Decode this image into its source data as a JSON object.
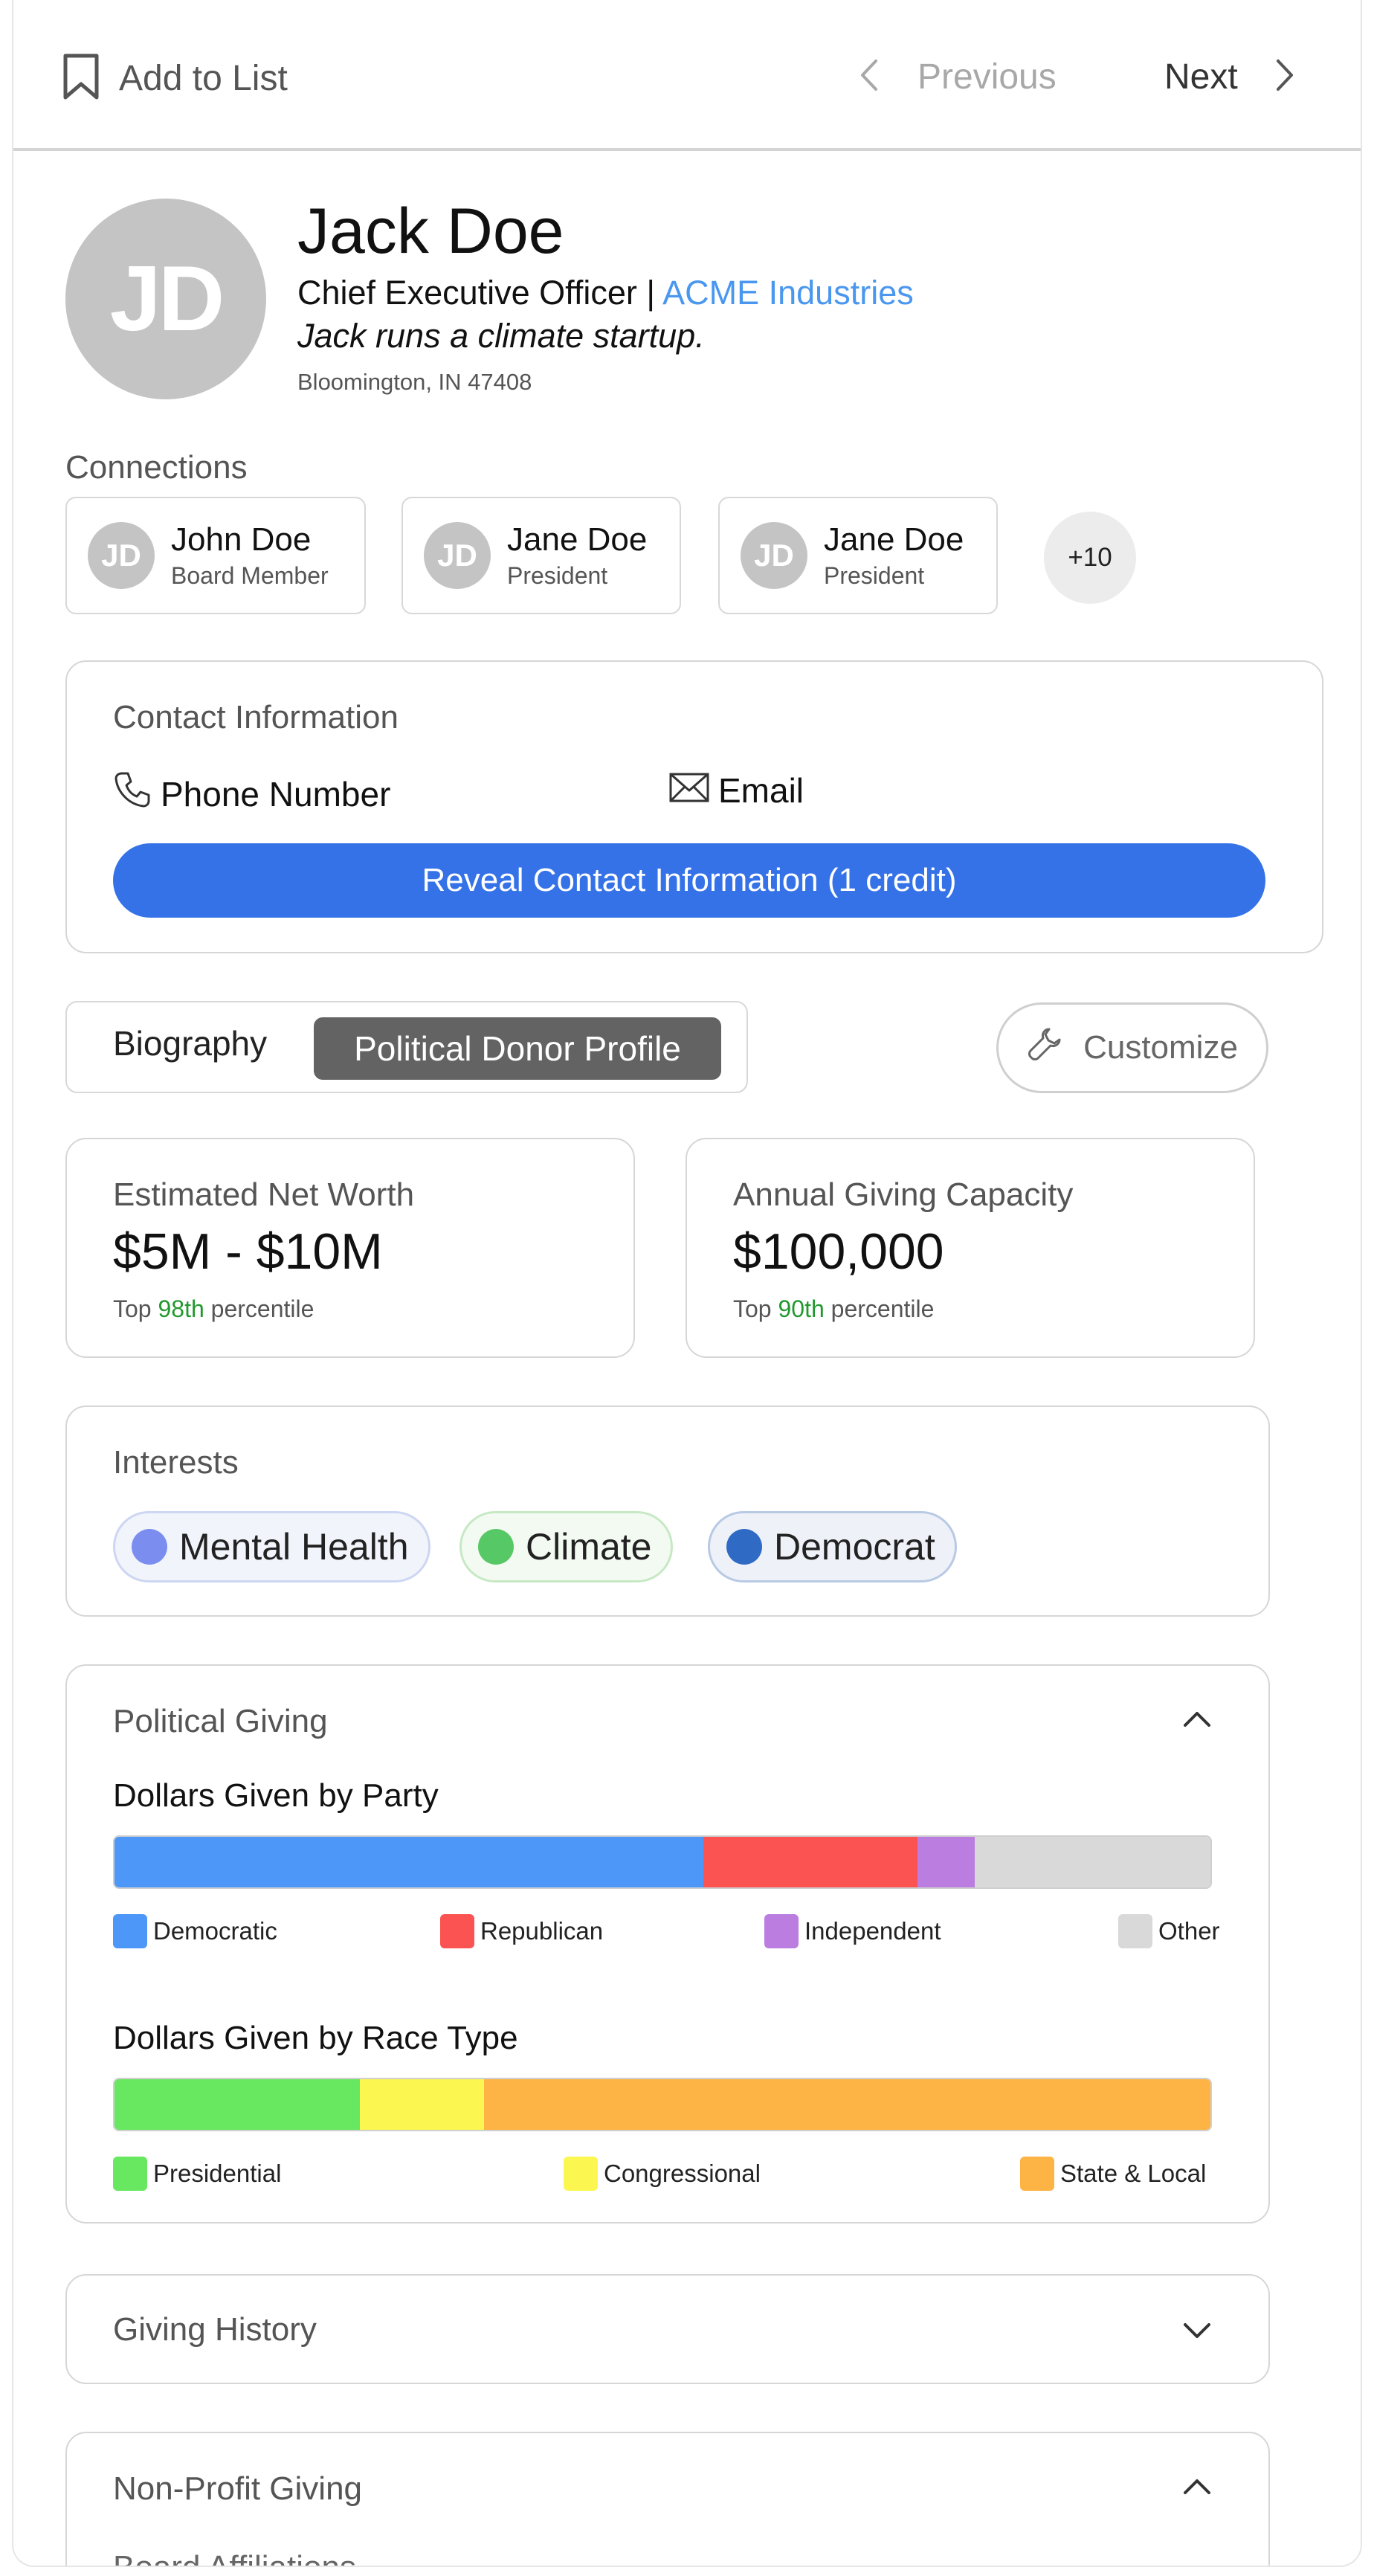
{
  "topbar": {
    "add_to_list": "Add to List",
    "previous": "Previous",
    "next": "Next"
  },
  "profile": {
    "initials": "JD",
    "name": "Jack Doe",
    "title": "Chief Executive Officer",
    "separator": "|",
    "company": "ACME Industries",
    "bio": "Jack runs a climate startup.",
    "location": "Bloomington, IN 47408"
  },
  "connections": {
    "title": "Connections",
    "items": [
      {
        "initials": "JD",
        "name": "John Doe",
        "role": "Board Member"
      },
      {
        "initials": "JD",
        "name": "Jane Doe",
        "role": "President"
      },
      {
        "initials": "JD",
        "name": "Jane Doe",
        "role": "President"
      }
    ],
    "more": "+10"
  },
  "contact": {
    "title": "Contact Information",
    "phone_label": "Phone Number",
    "email_label": "Email",
    "reveal_button": "Reveal Contact Information (1 credit)"
  },
  "tabs": {
    "biography": "Biography",
    "political": "Political Donor Profile",
    "customize": "Customize"
  },
  "stats": [
    {
      "label": "Estimated Net Worth",
      "value": "$5M - $10M",
      "pct_prefix": "Top",
      "pct_value": "98th",
      "pct_suffix": "percentile"
    },
    {
      "label": "Annual Giving Capacity",
      "value": "$100,000",
      "pct_prefix": "Top",
      "pct_value": "90th",
      "pct_suffix": "percentile"
    }
  ],
  "interests": {
    "title": "Interests",
    "items": [
      {
        "label": "Mental Health",
        "color": "#7b8ef0"
      },
      {
        "label": "Climate",
        "color": "#57c866"
      },
      {
        "label": "Democrat",
        "color": "#2f6ac4"
      }
    ]
  },
  "political_giving": {
    "title": "Political Giving",
    "party": {
      "title": "Dollars Given by Party",
      "segments": [
        {
          "label": "Democratic",
          "share": 0.537,
          "color": "#4c97f7"
        },
        {
          "label": "Republican",
          "share": 0.196,
          "color": "#fb5252"
        },
        {
          "label": "Independent",
          "share": 0.052,
          "color": "#bb7de0"
        },
        {
          "label": "Other",
          "share": 0.215,
          "color": "#d9d9d9"
        }
      ]
    },
    "race": {
      "title": "Dollars Given by Race Type",
      "segments": [
        {
          "label": "Presidential",
          "share": 0.224,
          "color": "#67e860"
        },
        {
          "label": "Congressional",
          "share": 0.113,
          "color": "#fcf750"
        },
        {
          "label": "State & Local",
          "share": 0.663,
          "color": "#fdb444"
        }
      ]
    }
  },
  "giving_history": {
    "title": "Giving History"
  },
  "nonprofit": {
    "title": "Non-Profit Giving",
    "sub": "Board Affiliations"
  }
}
